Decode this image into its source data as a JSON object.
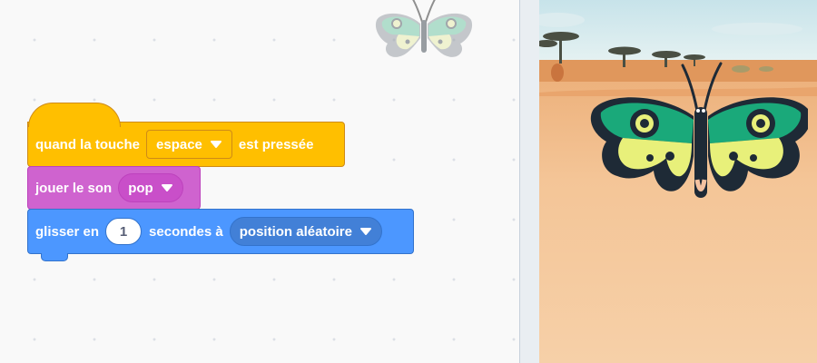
{
  "code_area": {
    "ghost_sprite_icon": "butterfly-icon",
    "script": {
      "event_block": {
        "label_before": "quand la touche",
        "key_value": "espace",
        "label_after": "est pressée"
      },
      "sound_block": {
        "label": "jouer le son",
        "sound_value": "pop"
      },
      "motion_block": {
        "label_before": "glisser en",
        "seconds_value": "1",
        "label_middle": "secondes à",
        "target_value": "position aléatoire"
      }
    }
  },
  "stage": {
    "backdrop": "savanna",
    "sprite_icon": "butterfly-icon"
  },
  "colors": {
    "event": "#ffbf00",
    "sound": "#cf63cf",
    "motion": "#4c97ff",
    "butterfly_green": "#1aa97a",
    "butterfly_yellow": "#e8f07a",
    "butterfly_dark": "#1e2a36"
  }
}
